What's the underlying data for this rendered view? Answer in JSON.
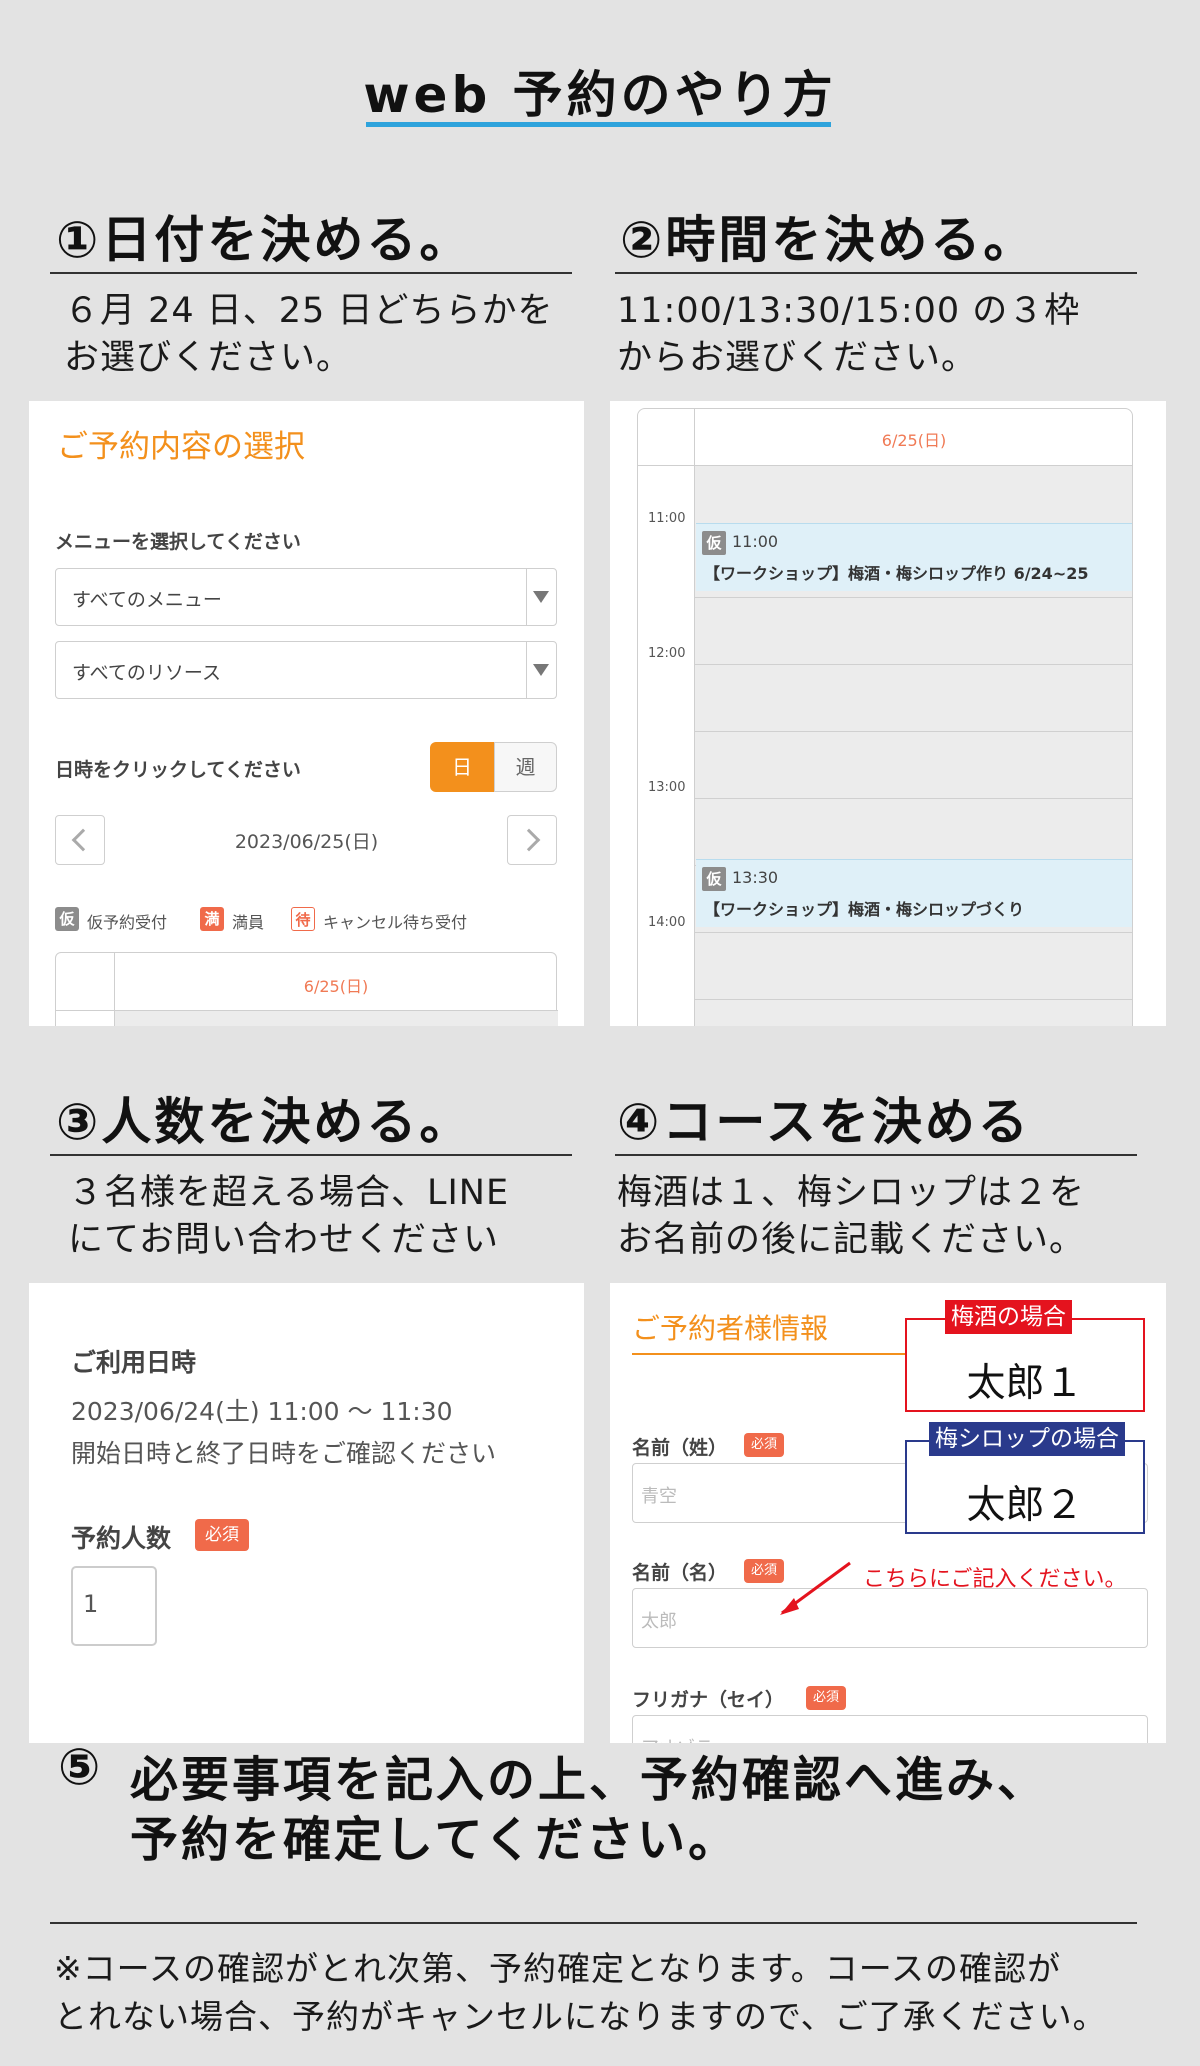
{
  "page_title": "web 予約のやり方",
  "steps": {
    "s1": {
      "heading": "①日付を決める。",
      "desc": "６月 24 日、25 日どちらかを\nお選びください。"
    },
    "s2": {
      "heading": "②時間を決める。",
      "desc": "11:00/13:30/15:00 の３枠\nからお選びください。"
    },
    "s3": {
      "heading": "③人数を決める。",
      "desc": "３名様を超える場合、LINE\nにてお問い合わせください"
    },
    "s4": {
      "heading": "④コースを決める",
      "desc": "梅酒は１、梅シロップは２を\nお名前の後に記載ください。"
    },
    "s5": {
      "number": "⑤",
      "line1": "必要事項を記入の上、予約確認へ進み、",
      "line2": "予約を確定してください。"
    }
  },
  "panel1": {
    "title": "ご予約内容の選択",
    "menu_label": "メニューを選択してください",
    "menu_select": "すべてのメニュー",
    "resource_select": "すべてのリソース",
    "datetime_label": "日時をクリックしてください",
    "toggle_day": "日",
    "toggle_week": "週",
    "current_date": "2023/06/25(日)",
    "legend": {
      "temp_badge": "仮",
      "temp_label": "仮予約受付",
      "full_badge": "満",
      "full_label": "満員",
      "wait_badge": "待",
      "wait_label": "キャンセル待ち受付"
    },
    "cal_header": "6/25(日)"
  },
  "panel2": {
    "cal_header": "6/25(日)",
    "times": [
      "11:00",
      "12:00",
      "13:00",
      "14:00"
    ],
    "events": [
      {
        "badge": "仮",
        "time": "11:00",
        "title": "【ワークショップ】梅酒・梅シロップ作り 6/24~25"
      },
      {
        "badge": "仮",
        "time": "13:30",
        "title": "【ワークショップ】梅酒・梅シロップづくり"
      }
    ]
  },
  "panel3": {
    "date_label": "ご利用日時",
    "date_value": "2023/06/24(土) 11:00 〜 11:30",
    "date_note": "開始日時と終了日時をご確認ください",
    "count_label": "予約人数",
    "required": "必須",
    "count_value": "1"
  },
  "panel4": {
    "title": "ご予約者様情報",
    "last_name_label": "名前（姓）",
    "last_name_placeholder": "青空",
    "first_name_label": "名前（名）",
    "first_name_placeholder": "太郎",
    "kana_label": "フリガナ（セイ）",
    "kana_placeholder": "アオゾラ",
    "required": "必須",
    "callout1": {
      "tag": "梅酒の場合",
      "name": "太郎１",
      "color": "#e4131e"
    },
    "callout2": {
      "tag": "梅シロップの場合",
      "name": "太郎２",
      "color": "#2a3a8c"
    },
    "note": "こちらにご記入ください。"
  },
  "footer_note": {
    "line1": "※コースの確認がとれ次第、予約確定となります。コースの確認が",
    "line2": "とれない場合、予約がキャンセルになりますので、ご了承ください。"
  },
  "colors": {
    "accent_orange": "#f3901c",
    "title_underline": "#2ea3dc",
    "required_red": "#f06a4a",
    "event_bg": "#dff0f8"
  }
}
